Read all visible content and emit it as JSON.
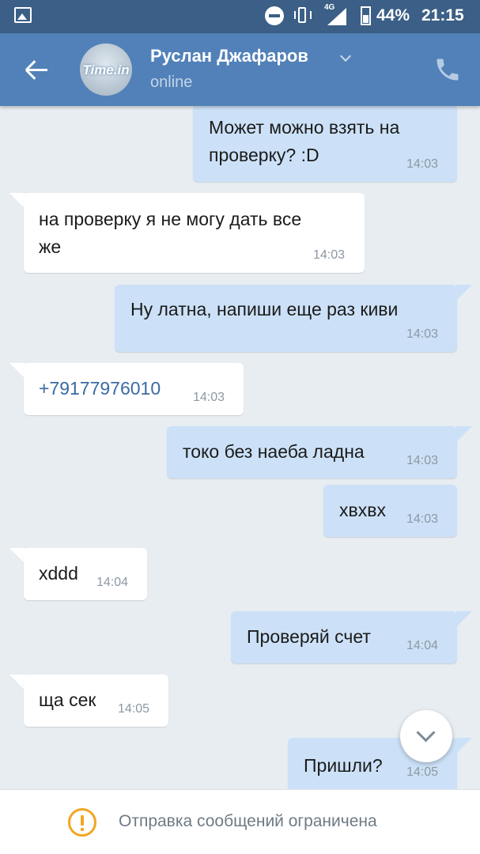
{
  "status_bar": {
    "network": "4G",
    "battery": "44%",
    "time": "21:15"
  },
  "header": {
    "contact_name": "Руслан Джафаров",
    "status": "online",
    "avatar_text": "Time.in"
  },
  "messages": [
    {
      "direction": "out",
      "text": "Может можно взять на\nпроверку? :D",
      "time": "14:03"
    },
    {
      "direction": "in",
      "text": "на проверку я не могу дать все\nже",
      "time": "14:03"
    },
    {
      "direction": "out",
      "text": "Ну латна, напиши еще раз киви",
      "time": "14:03"
    },
    {
      "direction": "in",
      "text": "+79177976010",
      "time": "14:03"
    },
    {
      "direction": "out",
      "text": "токо без наеба ладна",
      "time": "14:03"
    },
    {
      "direction": "out",
      "text": "хвхвх",
      "time": "14:03"
    },
    {
      "direction": "in",
      "text": "xddd",
      "time": "14:04"
    },
    {
      "direction": "out",
      "text": "Проверяй счет",
      "time": "14:04"
    },
    {
      "direction": "in",
      "text": "ща сек",
      "time": "14:05"
    },
    {
      "direction": "out",
      "text": "Пришли?",
      "time": "14:05"
    }
  ],
  "notice": {
    "text": "Отправка сообщений ограничена"
  },
  "colors": {
    "header": "#5181b8",
    "status_bar": "#3b5f86",
    "outgoing_bubble": "#cce1f7",
    "incoming_bubble": "#ffffff",
    "background": "#e8edf2",
    "warning": "#f2a623"
  }
}
